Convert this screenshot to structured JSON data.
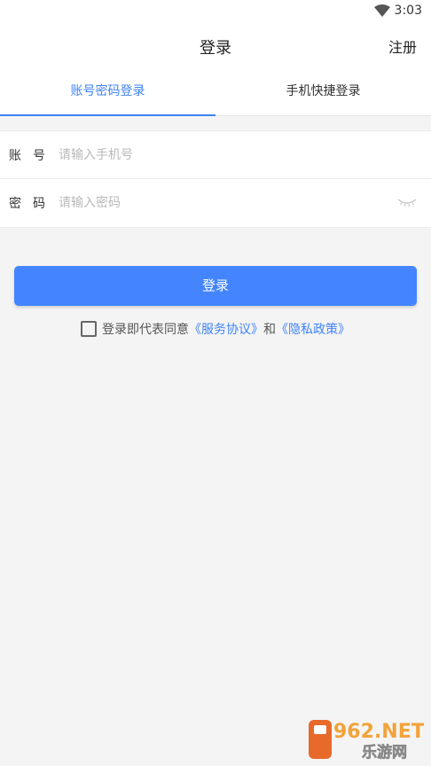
{
  "status_bar": {
    "time": "3:03"
  },
  "header": {
    "title": "登录",
    "register_label": "注册"
  },
  "tabs": [
    {
      "label": "账号密码登录",
      "active": true
    },
    {
      "label": "手机快捷登录",
      "active": false
    }
  ],
  "form": {
    "account": {
      "label": "账号",
      "placeholder": "请输入手机号"
    },
    "password": {
      "label": "密码",
      "placeholder": "请输入密码"
    }
  },
  "login_button": "登录",
  "agreement": {
    "prefix": "登录即代表同意",
    "service_link": "《服务协议》",
    "conjunction": "和",
    "privacy_link": "《隐私政策》",
    "checked": false
  },
  "watermark": {
    "top": "962.NET",
    "bottom": "乐游网"
  },
  "colors": {
    "accent": "#3f83f8",
    "button": "#4485ff",
    "background": "#f4f4f4"
  }
}
